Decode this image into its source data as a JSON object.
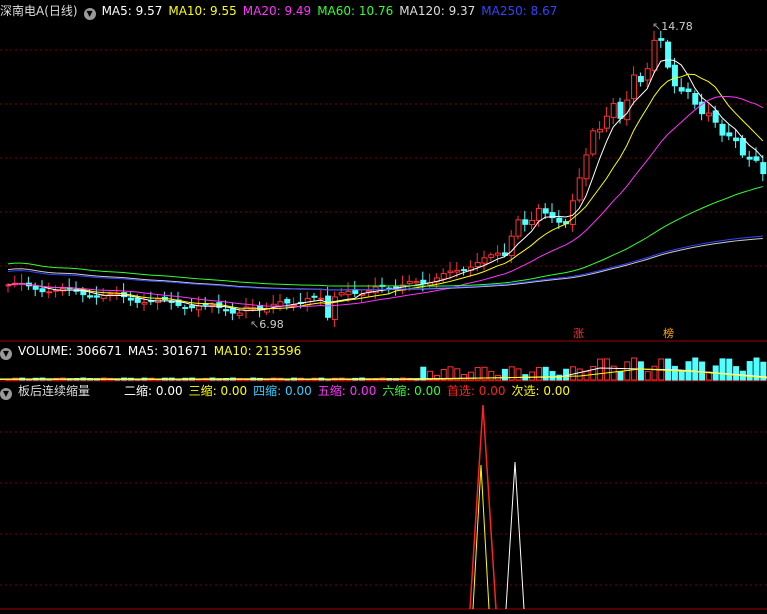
{
  "main_panel": {
    "stock_name": "深南电A(日线)",
    "indicators": [
      {
        "label": "MA5: 9.57",
        "color": "#ffffff"
      },
      {
        "label": "MA10: 9.55",
        "color": "#ffff00"
      },
      {
        "label": "MA20: 9.49",
        "color": "#ff33ff"
      },
      {
        "label": "MA60: 10.76",
        "color": "#33ff33"
      },
      {
        "label": "MA120: 9.37",
        "color": "#dddddd"
      },
      {
        "label": "MA250: 8.67",
        "color": "#3344ff"
      }
    ],
    "high_label": "14.78",
    "low_label": "6.98",
    "markers": [
      "涨",
      "榜"
    ]
  },
  "volume_panel": {
    "indicators": [
      {
        "label": "VOLUME: 306671",
        "color": "#ffffff"
      },
      {
        "label": "MA5: 301671",
        "color": "#ffffff"
      },
      {
        "label": "MA10: 213596",
        "color": "#ffff00"
      }
    ]
  },
  "signal_panel": {
    "title": "板后连续缩量",
    "indicators": [
      {
        "label": "二缩: 0.00",
        "color": "#ffffff"
      },
      {
        "label": "三缩: 0.00",
        "color": "#ffff00"
      },
      {
        "label": "四缩: 0.00",
        "color": "#33ccff"
      },
      {
        "label": "五缩: 0.00",
        "color": "#ff33ff"
      },
      {
        "label": "六缩: 0.00",
        "color": "#33ff33"
      },
      {
        "label": "首选: 0.00",
        "color": "#ff2222"
      },
      {
        "label": "次选: 0.00",
        "color": "#ffff00"
      }
    ]
  },
  "colors": {
    "up": "#ff3232",
    "down": "#54ffff",
    "grid": "#7a0000",
    "separator": "#a00000"
  }
}
